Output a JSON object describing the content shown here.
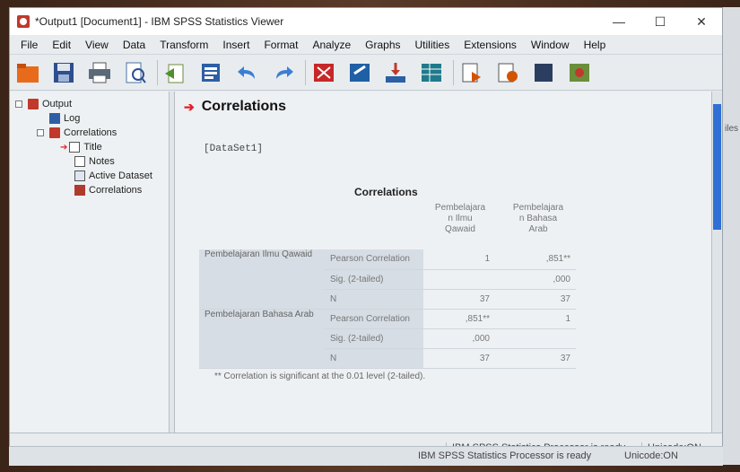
{
  "window": {
    "title": "*Output1 [Document1] - IBM SPSS Statistics Viewer",
    "controls": {
      "minimize": "—",
      "maximize": "☐",
      "close": "✕"
    }
  },
  "menu": [
    "File",
    "Edit",
    "View",
    "Data",
    "Transform",
    "Insert",
    "Format",
    "Analyze",
    "Graphs",
    "Utilities",
    "Extensions",
    "Window",
    "Help"
  ],
  "toolbar": {
    "icons": [
      "open-icon",
      "save-icon",
      "print-icon",
      "print-preview-icon",
      "export-icon",
      "recall-dialog-icon",
      "undo-icon",
      "redo-icon",
      "goto-data-icon",
      "goto-case-icon",
      "goto-variable-icon",
      "variables-icon",
      "designate-window-icon",
      "run-script-icon",
      "stop-icon",
      "create-script-icon"
    ]
  },
  "outline": {
    "root": "Output",
    "log": "Log",
    "correlations_node": "Correlations",
    "children": [
      "Title",
      "Notes",
      "Active Dataset",
      "Correlations"
    ]
  },
  "viewer": {
    "heading": "Correlations",
    "dataset": "[DataSet1]",
    "table_title": "Correlations",
    "columns": [
      [
        "Pembelajara",
        "n Ilmu",
        "Qawaid"
      ],
      [
        "Pembelajara",
        "n Bahasa",
        "Arab"
      ]
    ],
    "rows": [
      {
        "label": "Pembelajaran Ilmu Qawaid",
        "stats": [
          {
            "name": "Pearson Correlation",
            "v1": "1",
            "v2": ",851**"
          },
          {
            "name": "Sig. (2-tailed)",
            "v1": "",
            "v2": ",000"
          },
          {
            "name": "N",
            "v1": "37",
            "v2": "37"
          }
        ]
      },
      {
        "label": "Pembelajaran Bahasa Arab",
        "stats": [
          {
            "name": "Pearson Correlation",
            "v1": ",851**",
            "v2": "1"
          },
          {
            "name": "Sig. (2-tailed)",
            "v1": ",000",
            "v2": ""
          },
          {
            "name": "N",
            "v1": "37",
            "v2": "37"
          }
        ]
      }
    ],
    "footnote": "** Correlation is significant at the 0.01 level (2-tailed)."
  },
  "status": {
    "processor": "IBM SPSS Statistics Processor is ready",
    "unicode": "Unicode:ON"
  },
  "background_window": {
    "partial_text": "iles",
    "processor": "IBM SPSS Statistics Processor is ready",
    "unicode": "Unicode:ON"
  },
  "colors": {
    "scroll_thumb": "#2f6fd6",
    "heading_arrow": "#e0202a",
    "table_header_bg": "#d6dde4"
  }
}
